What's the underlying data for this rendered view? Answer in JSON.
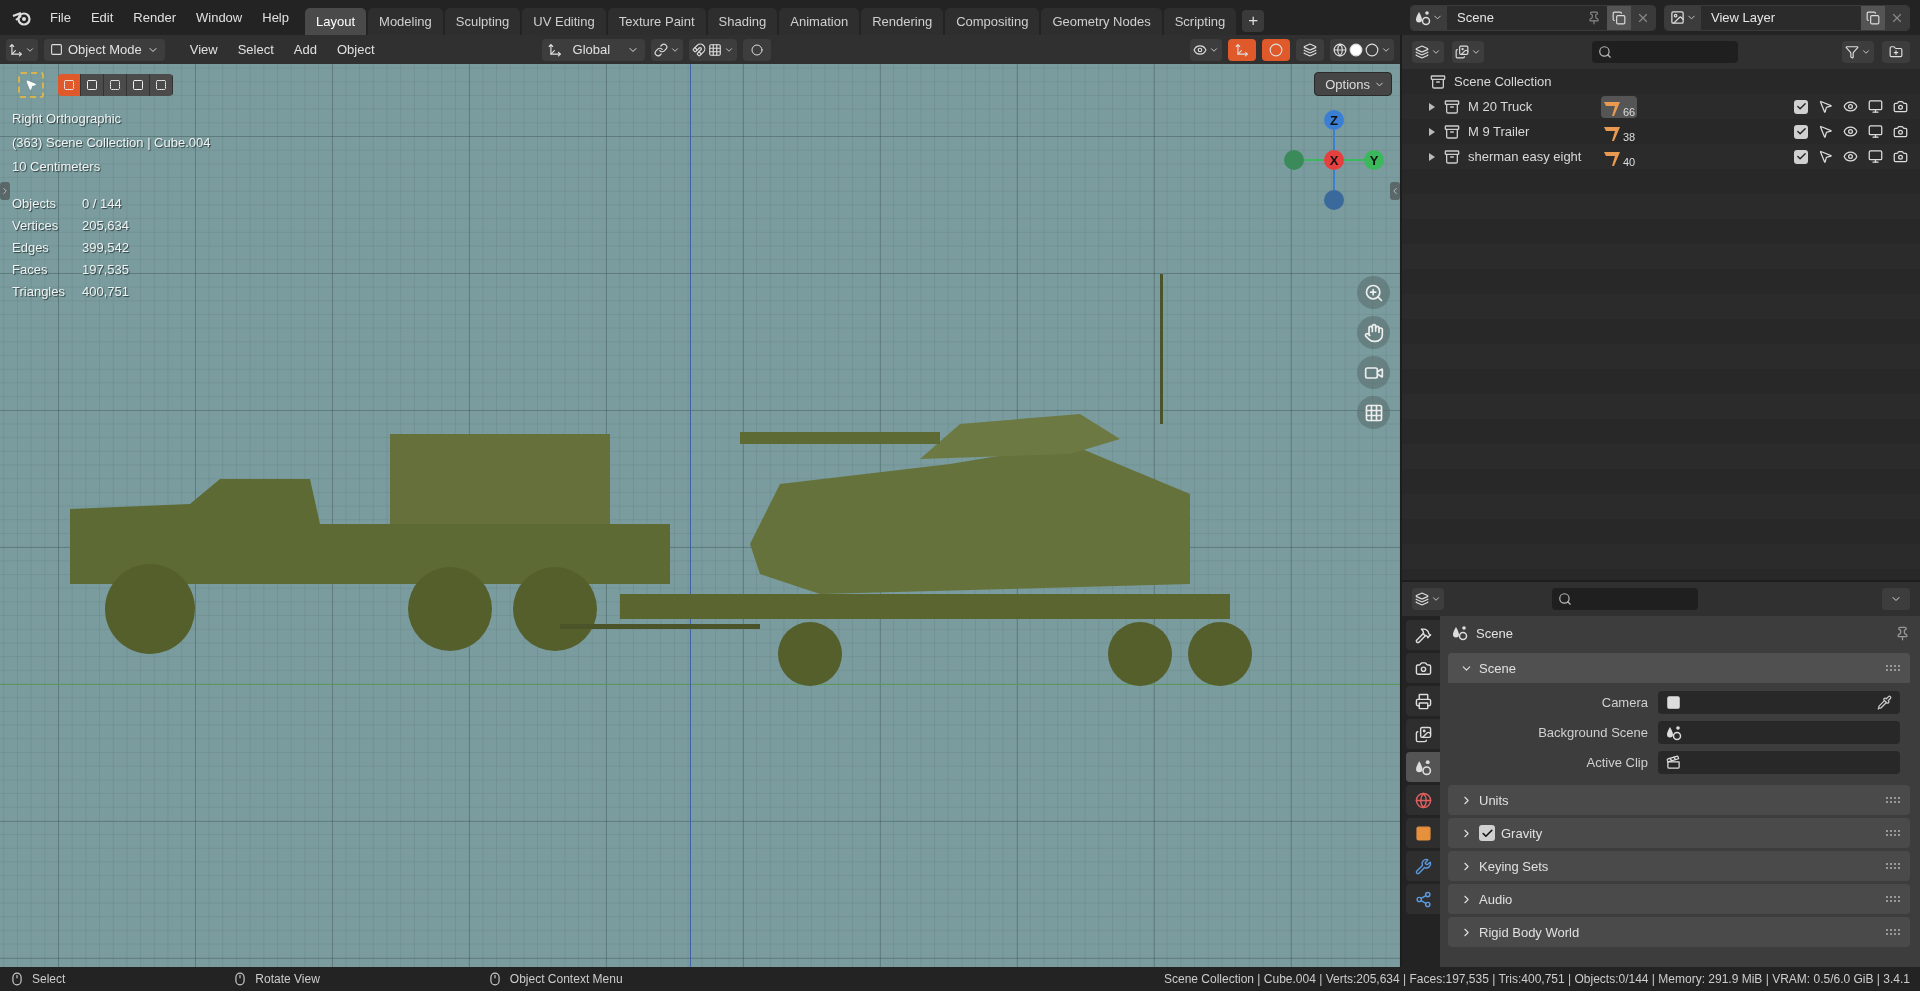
{
  "menu": [
    "File",
    "Edit",
    "Render",
    "Window",
    "Help"
  ],
  "workspace_tabs": [
    {
      "label": "Layout",
      "selected": true
    },
    {
      "label": "Modeling",
      "selected": false
    },
    {
      "label": "Sculpting",
      "selected": false
    },
    {
      "label": "UV Editing",
      "selected": false
    },
    {
      "label": "Texture Paint",
      "selected": false
    },
    {
      "label": "Shading",
      "selected": false
    },
    {
      "label": "Animation",
      "selected": false
    },
    {
      "label": "Rendering",
      "selected": false
    },
    {
      "label": "Compositing",
      "selected": false
    },
    {
      "label": "Geometry Nodes",
      "selected": false
    },
    {
      "label": "Scripting",
      "selected": false
    }
  ],
  "add_tab": "+",
  "scene_selector": "Scene",
  "view_layer": "View Layer",
  "viewport_header": {
    "mode": "Object Mode",
    "menus": [
      "View",
      "Select",
      "Add",
      "Object"
    ],
    "orientation": "Global"
  },
  "viewport": {
    "select_modes": [
      {
        "selected": true
      },
      {
        "selected": false
      },
      {
        "selected": false
      },
      {
        "selected": false
      },
      {
        "selected": false
      }
    ],
    "view_name": "Right Orthographic",
    "collection_info": "(363) Scene Collection | Cube.004",
    "scale": "10 Centimeters",
    "stats": [
      {
        "label": "Objects",
        "value": "0 / 144"
      },
      {
        "label": "Vertices",
        "value": "205,634"
      },
      {
        "label": "Edges",
        "value": "399,542"
      },
      {
        "label": "Faces",
        "value": "197,535"
      },
      {
        "label": "Triangles",
        "value": "400,751"
      }
    ],
    "options": "Options",
    "gizmo": [
      {
        "label": "Z",
        "color": "#3b7fd4"
      },
      {
        "label": "X",
        "color": "#e5403f"
      },
      {
        "label": "Y",
        "color": "#3cb85c"
      }
    ]
  },
  "outliner": {
    "root": "Scene Collection",
    "collections": [
      {
        "name": "M 20 Truck",
        "count": "66",
        "active": true,
        "expanded": false,
        "checked": true
      },
      {
        "name": "M 9 Trailer",
        "count": "38",
        "active": false,
        "expanded": false,
        "checked": true
      },
      {
        "name": "sherman easy eight",
        "count": "40",
        "active": false,
        "expanded": false,
        "checked": true
      }
    ]
  },
  "properties": {
    "tabs": [
      {
        "kind": "tool",
        "selected": false
      },
      {
        "kind": "render",
        "selected": false
      },
      {
        "kind": "output",
        "selected": false
      },
      {
        "kind": "view-layer",
        "selected": false
      },
      {
        "kind": "scene",
        "selected": true
      },
      {
        "kind": "world",
        "selected": false
      },
      {
        "kind": "object",
        "selected": false
      },
      {
        "kind": "modifier",
        "selected": false
      },
      {
        "kind": "particles",
        "selected": false
      }
    ],
    "title": "Scene",
    "panels": [
      {
        "title": "Scene",
        "expanded": true,
        "fields": [
          {
            "label": "Camera",
            "kind": "camera"
          },
          {
            "label": "Background Scene",
            "kind": "scene"
          },
          {
            "label": "Active Clip",
            "kind": "clip"
          }
        ]
      },
      {
        "title": "Units",
        "expanded": false
      },
      {
        "title": "Gravity",
        "expanded": false,
        "checked": true
      },
      {
        "title": "Keying Sets",
        "expanded": false
      },
      {
        "title": "Audio",
        "expanded": false
      },
      {
        "title": "Rigid Body World",
        "expanded": false
      }
    ]
  },
  "status_bar": {
    "hints": [
      "Select",
      "Rotate View",
      "Object Context Menu"
    ],
    "stats": "Scene Collection | Cube.004 | Verts:205,634 | Faces:197,535 | Tris:400,751 | Objects:0/144 | Memory: 291.9 MiB | VRAM: 0.5/6.0 GiB | 3.4.1"
  }
}
